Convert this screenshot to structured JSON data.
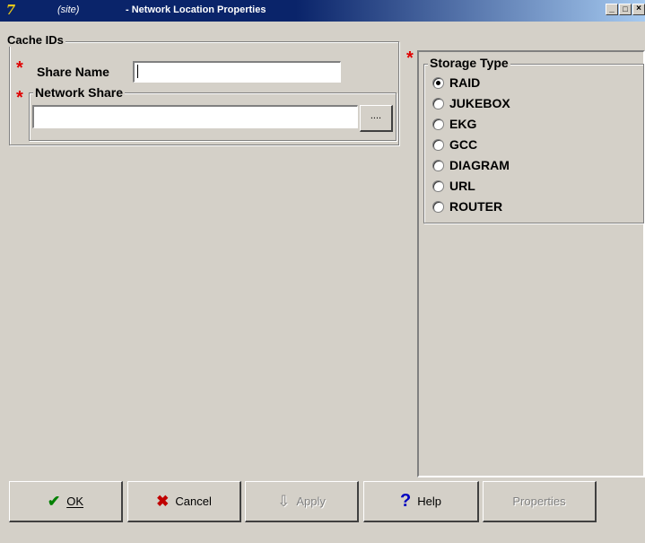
{
  "window": {
    "site": "(site)",
    "title": "- Network Location Properties",
    "minimize_glyph": "_",
    "maximize_glyph": "□",
    "close_glyph": "×",
    "app_icon_glyph": "7"
  },
  "cache_ids": {
    "legend": "Cache IDs",
    "required_marker": "*",
    "share_name_label": "Share Name",
    "share_name_value": "",
    "network_share_label": "Network Share",
    "network_share_value": "",
    "browse_label": "...."
  },
  "storage_type": {
    "legend": "Storage Type",
    "required_marker": "*",
    "selected": "RAID",
    "options": [
      "RAID",
      "JUKEBOX",
      "EKG",
      "GCC",
      "DIAGRAM",
      "URL",
      "ROUTER"
    ]
  },
  "buttons": {
    "ok_label": "OK",
    "cancel_label": "Cancel",
    "apply_label": "Apply",
    "help_label": "Help",
    "properties_label": "Properties"
  },
  "colors": {
    "title_bar": "#0a246a",
    "required": "#e00000",
    "ok_icon": "#008000",
    "cancel_icon": "#c00000",
    "help_icon": "#0000c0"
  }
}
